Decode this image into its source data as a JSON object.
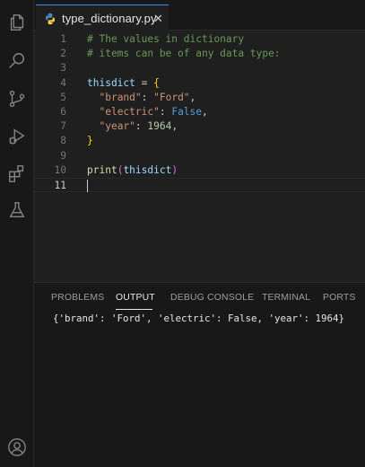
{
  "tab": {
    "filename": "type_dictionary.py",
    "close_glyph": "✕",
    "icon": "python-icon"
  },
  "activity_bar": {
    "icons": [
      "files-icon",
      "search-icon",
      "source-control-icon",
      "run-debug-icon",
      "extensions-icon",
      "testing-icon",
      "account-icon"
    ]
  },
  "editor": {
    "lines": [
      {
        "num": "1",
        "tokens": [
          {
            "t": "# The values in dictionary",
            "c": "comment"
          }
        ]
      },
      {
        "num": "2",
        "tokens": [
          {
            "t": "# items can be of any data type:",
            "c": "comment"
          }
        ]
      },
      {
        "num": "3",
        "tokens": []
      },
      {
        "num": "4",
        "tokens": [
          {
            "t": "thisdict",
            "c": "var"
          },
          {
            "t": " = ",
            "c": "plain"
          },
          {
            "t": "{",
            "c": "brace"
          }
        ]
      },
      {
        "num": "5",
        "tokens": [
          {
            "t": "  ",
            "c": "plain"
          },
          {
            "t": "\"brand\"",
            "c": "str"
          },
          {
            "t": ": ",
            "c": "plain"
          },
          {
            "t": "\"Ford\"",
            "c": "str"
          },
          {
            "t": ",",
            "c": "plain"
          }
        ]
      },
      {
        "num": "6",
        "tokens": [
          {
            "t": "  ",
            "c": "plain"
          },
          {
            "t": "\"electric\"",
            "c": "str"
          },
          {
            "t": ": ",
            "c": "plain"
          },
          {
            "t": "False",
            "c": "const"
          },
          {
            "t": ",",
            "c": "plain"
          }
        ]
      },
      {
        "num": "7",
        "tokens": [
          {
            "t": "  ",
            "c": "plain"
          },
          {
            "t": "\"year\"",
            "c": "str"
          },
          {
            "t": ": ",
            "c": "plain"
          },
          {
            "t": "1964",
            "c": "num"
          },
          {
            "t": ",",
            "c": "plain"
          }
        ]
      },
      {
        "num": "8",
        "tokens": [
          {
            "t": "}",
            "c": "brace"
          }
        ]
      },
      {
        "num": "9",
        "tokens": []
      },
      {
        "num": "10",
        "tokens": [
          {
            "t": "print",
            "c": "fn"
          },
          {
            "t": "(",
            "c": "paren"
          },
          {
            "t": "thisdict",
            "c": "var"
          },
          {
            "t": ")",
            "c": "paren"
          }
        ]
      },
      {
        "num": "11",
        "tokens": []
      }
    ],
    "current_line": "11"
  },
  "panel": {
    "tabs": [
      "PROBLEMS",
      "OUTPUT",
      "DEBUG CONSOLE",
      "TERMINAL",
      "PORTS"
    ],
    "active_tab": "OUTPUT",
    "output": "{'brand': 'Ford', 'electric': False, 'year': 1964}"
  }
}
